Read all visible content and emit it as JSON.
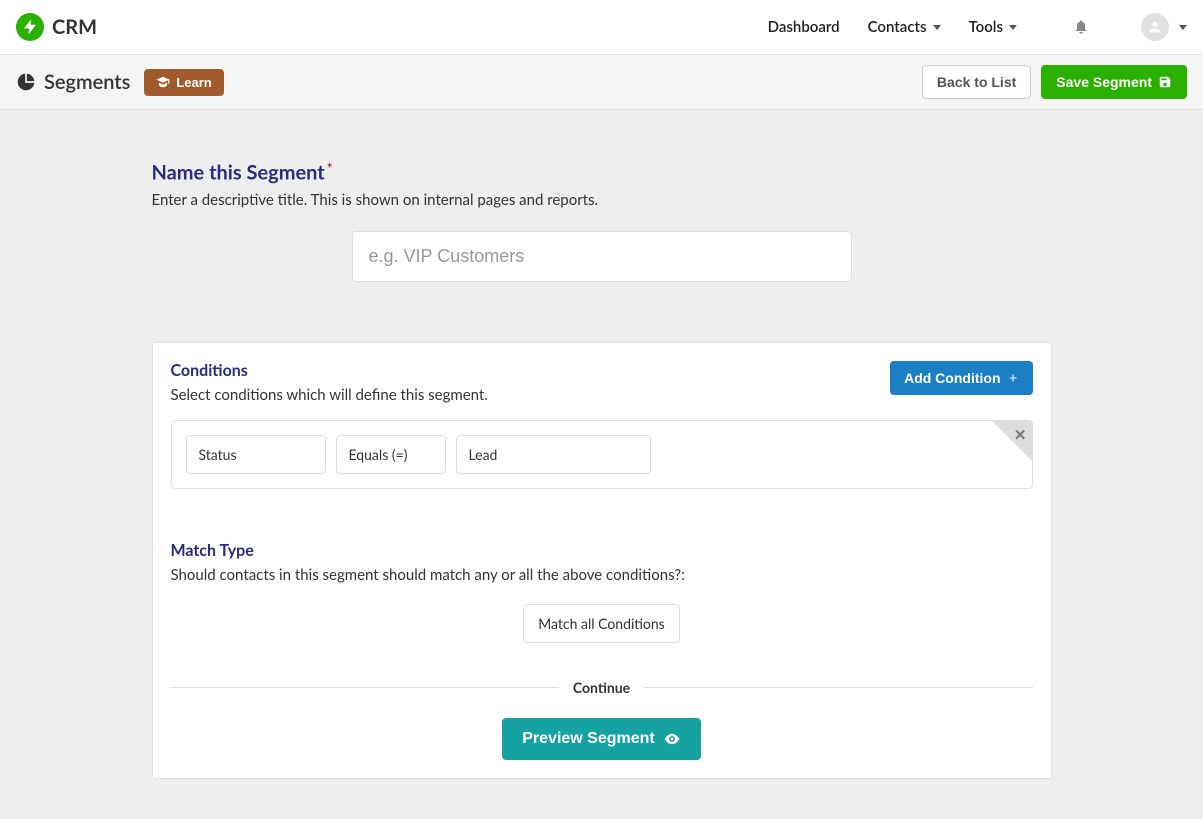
{
  "brand": "CRM",
  "nav": {
    "dashboard": "Dashboard",
    "contacts": "Contacts",
    "tools": "Tools"
  },
  "subbar": {
    "title": "Segments",
    "learn": "Learn",
    "back": "Back to List",
    "save": "Save Segment"
  },
  "name_section": {
    "title": "Name this Segment",
    "subtitle": "Enter a descriptive title. This is shown on internal pages and reports.",
    "placeholder": "e.g. VIP Customers",
    "value": ""
  },
  "conditions": {
    "title": "Conditions",
    "subtitle": "Select conditions which will define this segment.",
    "add": "Add Condition",
    "rows": [
      {
        "field": "Status",
        "op": "Equals (=)",
        "value": "Lead"
      }
    ]
  },
  "match": {
    "title": "Match Type",
    "subtitle": "Should contacts in this segment should match any or all the above conditions?:",
    "selected": "Match all Conditions"
  },
  "continue": {
    "label": "Continue",
    "preview": "Preview Segment"
  }
}
